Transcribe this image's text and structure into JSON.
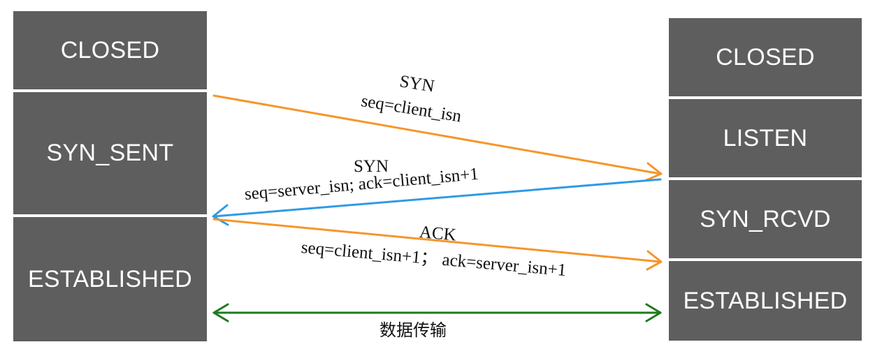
{
  "client": {
    "states": [
      "CLOSED",
      "SYN_SENT",
      "ESTABLISHED"
    ]
  },
  "server": {
    "states": [
      "CLOSED",
      "LISTEN",
      "SYN_RCVD",
      "ESTABLISHED"
    ]
  },
  "messages": [
    {
      "title": "SYN",
      "detail": "seq=client_isn",
      "direction": "client-to-server",
      "color": "#f5962a"
    },
    {
      "title": "SYN",
      "detail": "seq=server_isn; ack=client_isn+1",
      "direction": "server-to-client",
      "color": "#2f9be4"
    },
    {
      "title": "ACK",
      "detail": "seq=client_isn+1；  ack=server_isn+1",
      "direction": "client-to-server",
      "color": "#f5962a"
    }
  ],
  "data_transfer": {
    "label": "数据传输",
    "direction": "bidirectional",
    "color": "#1e7b1e"
  },
  "colors": {
    "state_box": "#5e5e5e",
    "state_text": "#ffffff"
  }
}
